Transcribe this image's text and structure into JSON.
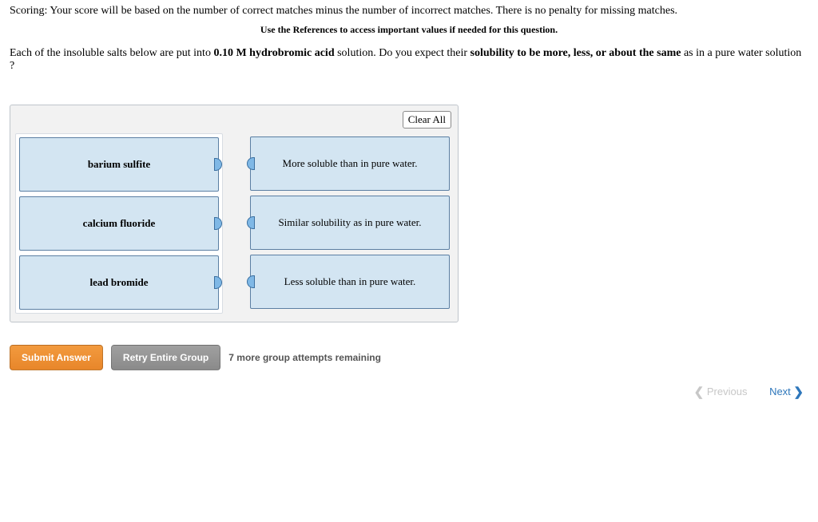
{
  "scoring": "Scoring: Your score will be based on the number of correct matches minus the number of incorrect matches. There is no penalty for missing matches.",
  "references": "Use the References to access important values if needed for this question.",
  "question_html": "Each of the insoluble salts below are put into <b>0.10 M hydrobromic acid</b> solution. Do you expect their <b>solubility to be more, less, or about the same</b> as in a pure water solution ?",
  "clear_all": "Clear All",
  "left_items": [
    "barium sulfite",
    "calcium fluoride",
    "lead bromide"
  ],
  "right_items": [
    "More soluble than in pure water.",
    "Similar solubility as in pure water.",
    "Less soluble than in pure water."
  ],
  "submit": "Submit Answer",
  "retry": "Retry Entire Group",
  "attempts": "7 more group attempts remaining",
  "previous": "Previous",
  "next": "Next"
}
